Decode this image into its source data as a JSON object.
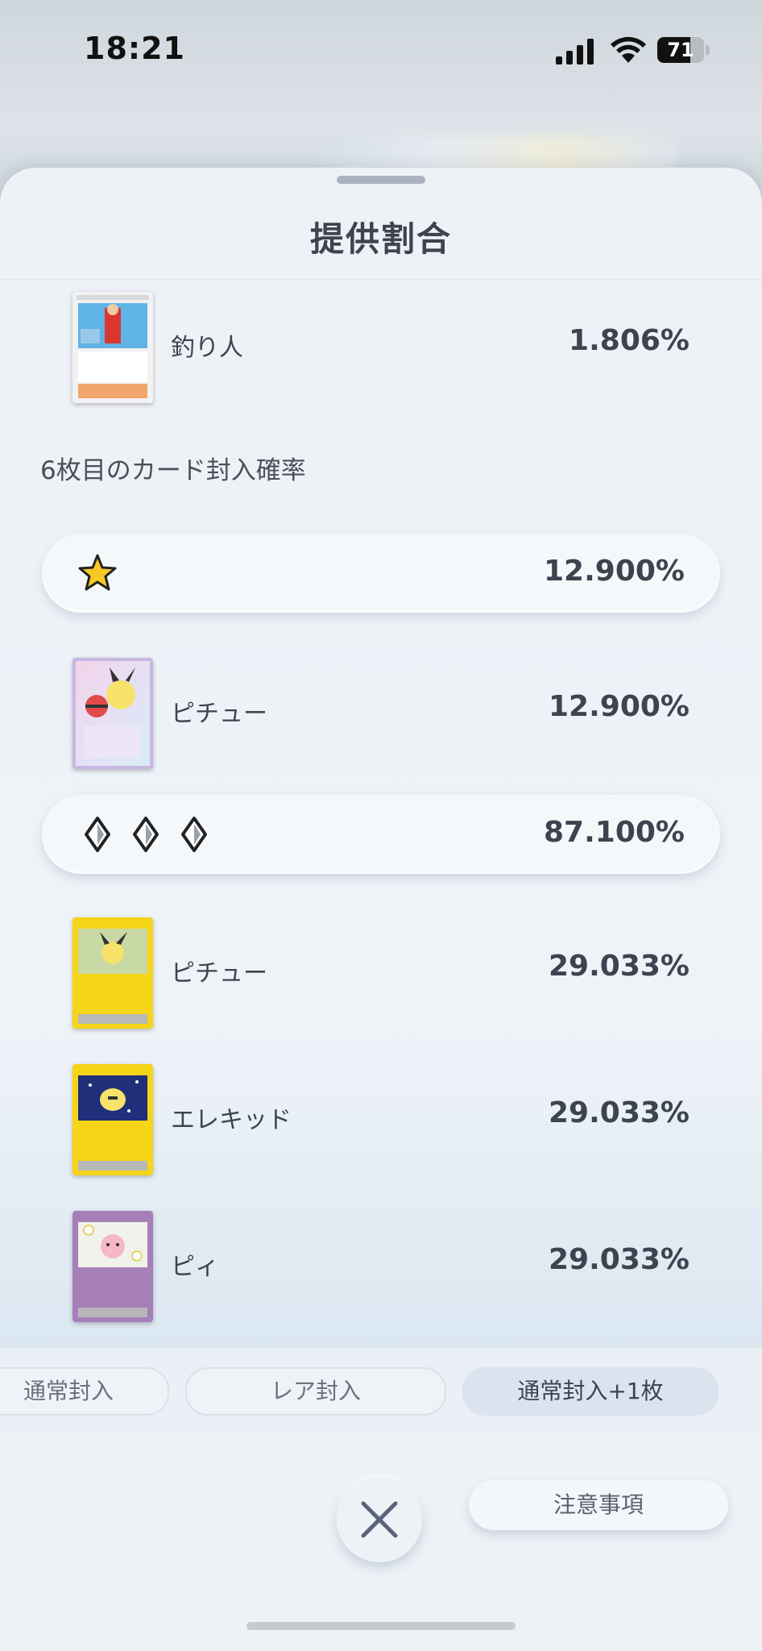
{
  "status_bar": {
    "time": "18:21",
    "battery_percent": "71",
    "battery_level": 0.71
  },
  "sheet": {
    "title": "提供割合"
  },
  "rows_top": [
    {
      "name": "釣り人",
      "percent": "1.806%",
      "card_type": "trainer"
    }
  ],
  "section_label": "6枚目のカード封入確率",
  "rarity_groups": [
    {
      "rarity_icon": "star-icon",
      "percent": "12.900%",
      "cards": [
        {
          "name": "ピチュー",
          "percent": "12.900%",
          "card_type": "rainbow-art"
        }
      ]
    },
    {
      "rarity_icon": "diamond-icon",
      "rarity_count": 3,
      "percent": "87.100%",
      "cards": [
        {
          "name": "ピチュー",
          "percent": "29.033%",
          "card_type": "lightning"
        },
        {
          "name": "エレキッド",
          "percent": "29.033%",
          "card_type": "lightning"
        },
        {
          "name": "ピィ",
          "percent": "29.033%",
          "card_type": "psychic"
        }
      ]
    }
  ],
  "tabs": [
    {
      "label": "通常封入",
      "active": false
    },
    {
      "label": "レア封入",
      "active": false
    },
    {
      "label": "通常封入+1枚",
      "active": true
    }
  ],
  "buttons": {
    "close": "close-icon",
    "notes": "注意事項"
  },
  "colors": {
    "accent": "#3d4450",
    "sheet_bg": "#eef2f7",
    "star": "#f6c929",
    "lightning": "#f6d417",
    "psychic": "#a77fb8"
  }
}
